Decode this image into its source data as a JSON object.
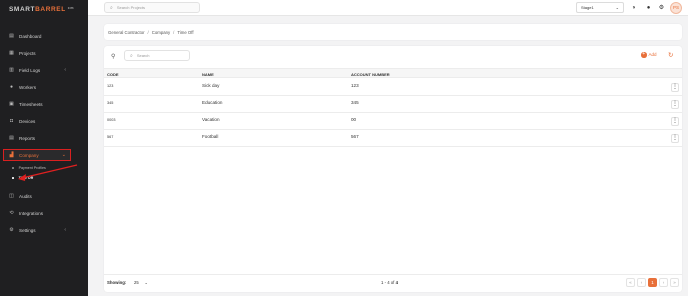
{
  "brand": {
    "smart": "SMART",
    "barrel": "BARREL",
    "badge": "cm"
  },
  "sidebar": {
    "items": [
      {
        "label": "Dashboard",
        "icon": "dashboard-icon",
        "glyph": "▤",
        "chevron": ""
      },
      {
        "label": "Projects",
        "icon": "folder-icon",
        "glyph": "▦",
        "chevron": ""
      },
      {
        "label": "Field Logs",
        "icon": "logbook-icon",
        "glyph": "▥",
        "chevron": "‹"
      },
      {
        "label": "Workers",
        "icon": "worker-icon",
        "glyph": "●",
        "chevron": ""
      },
      {
        "label": "Timesheets",
        "icon": "timesheet-icon",
        "glyph": "▣",
        "chevron": ""
      },
      {
        "label": "Devices",
        "icon": "device-icon",
        "glyph": "◘",
        "chevron": ""
      },
      {
        "label": "Reports",
        "icon": "report-icon",
        "glyph": "▤",
        "chevron": ""
      },
      {
        "label": "Company",
        "icon": "company-icon",
        "glyph": "▟",
        "chevron": "⌄"
      },
      {
        "label": "Audits",
        "icon": "audit-icon",
        "glyph": "◫",
        "chevron": ""
      },
      {
        "label": "Integrations",
        "icon": "integration-icon",
        "glyph": "⟲",
        "chevron": ""
      },
      {
        "label": "Settings",
        "icon": "gear-icon",
        "glyph": "⚙",
        "chevron": "‹"
      }
    ],
    "sub_items": [
      {
        "label": "Payment Profiles"
      },
      {
        "label": "Time Off"
      }
    ]
  },
  "topbar": {
    "search_placeholder": "Search Projects",
    "project_selected": "Stage1",
    "avatar_initials": "PS"
  },
  "breadcrumb": {
    "items": [
      "General Contractor",
      "Company",
      "Time Off"
    ],
    "separator": "/"
  },
  "table": {
    "search_placeholder": "Search",
    "add_label": "Add",
    "columns": [
      "CODE",
      "NAME",
      "ACCOUNT NUMBER"
    ],
    "rows": [
      {
        "code": "123",
        "name": "Sick day",
        "account": "123"
      },
      {
        "code": "345",
        "name": "Education",
        "account": "345"
      },
      {
        "code": "0003",
        "name": "Vacation",
        "account": "00"
      },
      {
        "code": "567",
        "name": "Football",
        "account": "567"
      }
    ]
  },
  "footer": {
    "showing_label": "Showing:",
    "per_page": "25",
    "range_text": "1 - 4 of",
    "range_total": "4",
    "current_page": "1"
  },
  "colors": {
    "accent": "#e8703a",
    "highlight": "#d92020",
    "sidebar_bg": "#1f1f21"
  }
}
